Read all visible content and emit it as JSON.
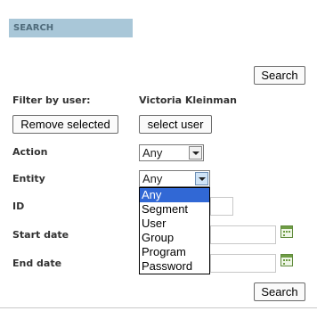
{
  "panel": {
    "title": "SEARCH"
  },
  "top_search_label": "Search",
  "filter": {
    "label": "Filter by user:",
    "user_name": "Victoria Kleinman",
    "remove_selected_label": "Remove selected",
    "select_user_label": "select user"
  },
  "action": {
    "label": "Action",
    "selected": "Any"
  },
  "entity": {
    "label": "Entity",
    "selected": "Any",
    "options": [
      "Any",
      "Segment",
      "User",
      "Group",
      "Program",
      "Password"
    ],
    "highlighted_index": 0
  },
  "id": {
    "label": "ID",
    "value": ""
  },
  "start_date": {
    "label": "Start date",
    "value": ""
  },
  "end_date": {
    "label": "End date",
    "value": ""
  },
  "bottom_search_label": "Search",
  "icons": {
    "date_picker": "calendar-icon",
    "select_arrow": "chevron-down-icon"
  },
  "colors": {
    "header_bg": "#a9c7d8",
    "header_text": "#4f6b7b",
    "dropdown_highlight": "#3168d5"
  }
}
